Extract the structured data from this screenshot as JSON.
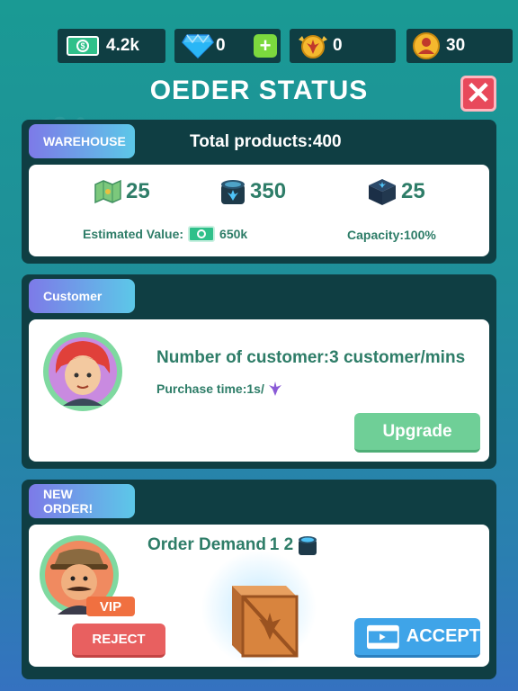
{
  "top_bar": {
    "cash": "4.2k",
    "diamonds": "0",
    "tokens": "0",
    "customers": "30"
  },
  "title": "OEDER STATUS",
  "warehouse": {
    "tag": "WAREHOUSE",
    "total_products": "Total products:400",
    "items": [
      {
        "icon": "map-icon",
        "value": "25"
      },
      {
        "icon": "jar-icon",
        "value": "350"
      },
      {
        "icon": "box-icon",
        "value": "25"
      }
    ],
    "estimated_label": "Estimated Value:",
    "estimated_value": "650k",
    "capacity": "Capacity:100%"
  },
  "customer": {
    "tag": "Customer",
    "count": "Number of customer:3 customer/mins",
    "purchase_time": "Purchase time:1s/",
    "upgrade_label": "Upgrade"
  },
  "new_order": {
    "tag": "NEW ORDER!",
    "demand": "Order Demand 1 2",
    "vip": "VIP",
    "reject_label": "REJECT",
    "accept_label": "ACCEPT"
  },
  "colors": {
    "panel": "#0f3e43",
    "accent_green": "#2e7d68",
    "reject": "#e86060",
    "accept": "#3fa4e8",
    "upgrade": "#6fcf97"
  }
}
